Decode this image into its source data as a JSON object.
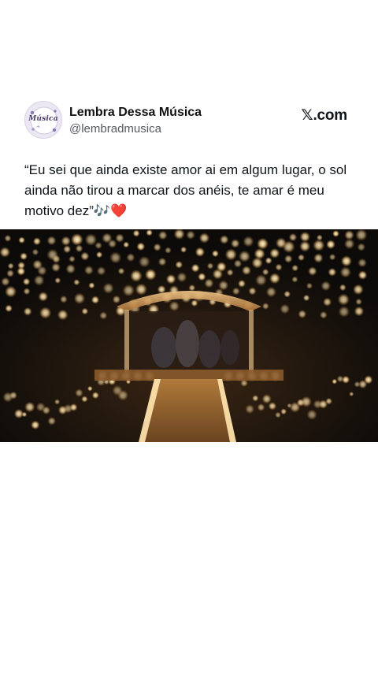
{
  "tweet": {
    "author": {
      "display_name": "Lembra Dessa Música",
      "handle": "@lembradmusica",
      "avatar_label": "Música",
      "avatar_icon": "music-logo-icon"
    },
    "platform_label": "X.com",
    "platform_mark": "𝕏",
    "platform_suffix": ".com",
    "text": "“Eu sei que ainda existe amor ai em algum lugar, o sol ainda não tirou a marcar dos anéis, te amar é meu motivo dez”🎶❤️",
    "media": {
      "type": "video-frame",
      "icon": "video-thumbnail-icon"
    }
  },
  "colors": {
    "background": "#ffffff",
    "text_primary": "#0f1419",
    "text_secondary": "#555a60",
    "avatar_bg": "#ece8f3",
    "media_bg": "#0d0b09",
    "light_warm": "#ffe9b8"
  }
}
